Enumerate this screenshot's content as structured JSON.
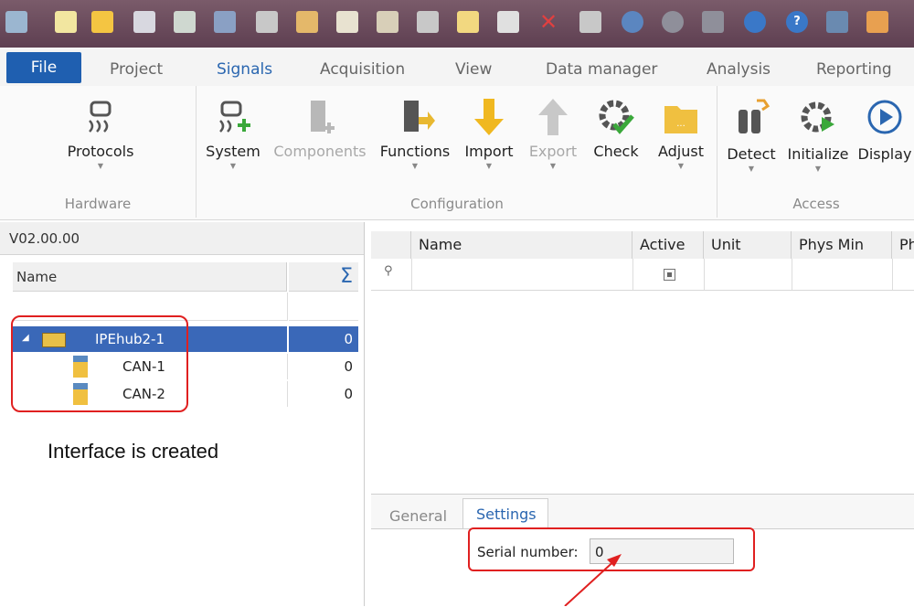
{
  "ribbon_tabs": [
    "File",
    "Project",
    "Signals",
    "Acquisition",
    "View",
    "Data manager",
    "Analysis",
    "Reporting"
  ],
  "groups": {
    "hardware": {
      "label": "Hardware",
      "buttons": [
        {
          "label": "Protocols"
        }
      ]
    },
    "configuration": {
      "label": "Configuration",
      "buttons": [
        {
          "label": "System"
        },
        {
          "label": "Components"
        },
        {
          "label": "Functions"
        },
        {
          "label": "Import"
        },
        {
          "label": "Export"
        },
        {
          "label": "Check"
        },
        {
          "label": "Adjust"
        }
      ]
    },
    "access": {
      "label": "Access",
      "buttons": [
        {
          "label": "Detect"
        },
        {
          "label": "Initialize"
        },
        {
          "label": "Display"
        }
      ]
    }
  },
  "left_panel": {
    "version": "V02.00.00",
    "name_header": "Name",
    "sum_symbol": "Σ",
    "tree": [
      {
        "name": "IPEhub2-1",
        "value": "0"
      },
      {
        "name": "CAN-1",
        "value": "0"
      },
      {
        "name": "CAN-2",
        "value": "0"
      }
    ],
    "annotation": "Interface is created"
  },
  "grid": {
    "columns": [
      "Name",
      "Active",
      "Unit",
      "Phys Min",
      "Ph"
    ],
    "filter_icon": "⚲"
  },
  "bottom_tabs": [
    "General",
    "Settings"
  ],
  "settings": {
    "serial_label": "Serial number:",
    "serial_value": "0"
  },
  "colors": {
    "qat": "#6b4c5e",
    "file_tab": "#1f5fb0",
    "selection": "#3a68b8",
    "annotation": "#e02020"
  }
}
